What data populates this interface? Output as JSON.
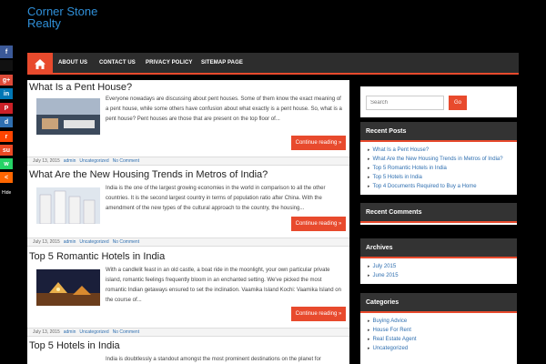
{
  "site": {
    "title": "Corner Stone Realty"
  },
  "nav": {
    "items": [
      "ABOUT US",
      "CONTACT US",
      "PRIVACY POLICY",
      "SITEMAP PAGE"
    ]
  },
  "share": {
    "hide_label": "Hide"
  },
  "posts": [
    {
      "title": "What Is a Pent House?",
      "excerpt": "Everyone nowadays are discussing about pent houses. Some of them know the exact meaning of a pent house, while some others have confusion about what exactly is a pent house. So, what is a pent house? Pent houses are those that are present on the top floor of...",
      "read_more": "Continue reading »",
      "date": "July 13, 2015",
      "author": "admin",
      "category": "Uncategorized",
      "comments": "No Comment"
    },
    {
      "title": "What Are the New Housing Trends in Metros of India?",
      "excerpt": "India is the one of the largest growing economies in the world in comparison to all the other countries. It is the second largest country in terms of population ratio after China. With the amendment of the new types of the cultural approach to the country, the housing...",
      "read_more": "Continue reading »",
      "date": "July 13, 2015",
      "author": "admin",
      "category": "Uncategorized",
      "comments": "No Comment"
    },
    {
      "title": "Top 5 Romantic Hotels in India",
      "excerpt": "With a candlelit feast in an old castle, a boat ride in the moonlight, your own particular private island, romantic feelings frequently bloom in an enchanted setting. We've picked the most romantic Indian getaways ensured to set the inclination. Vaamika Island Kochi: Vaamika Island on the course of...",
      "read_more": "Continue reading »",
      "date": "July 13, 2015",
      "author": "admin",
      "category": "Uncategorized",
      "comments": "No Comment"
    },
    {
      "title": "Top 5 Hotels in India",
      "excerpt": "India is doubtlessly a standout amongst the most prominent destinations on the planet for"
    }
  ],
  "sidebar": {
    "search": {
      "placeholder": "Search",
      "button": "Go"
    },
    "recent_posts": {
      "title": "Recent Posts",
      "items": [
        "What Is a Pent House?",
        "What Are the New Housing Trends in Metros of India?",
        "Top 5 Romantic Hotels in India",
        "Top 5 Hotels in India",
        "Top 4 Documents Required to Buy a Home"
      ]
    },
    "recent_comments": {
      "title": "Recent Comments"
    },
    "archives": {
      "title": "Archives",
      "items": [
        "July 2015",
        "June 2015"
      ]
    },
    "categories": {
      "title": "Categories",
      "items": [
        "Buying Advice",
        "House For Rent",
        "Real Estate Agent",
        "Uncategorized"
      ]
    }
  },
  "colors": {
    "accent": "#e84a2d",
    "link": "#2f8fd8",
    "bar": "#2d2d2d",
    "background": "#000000"
  }
}
